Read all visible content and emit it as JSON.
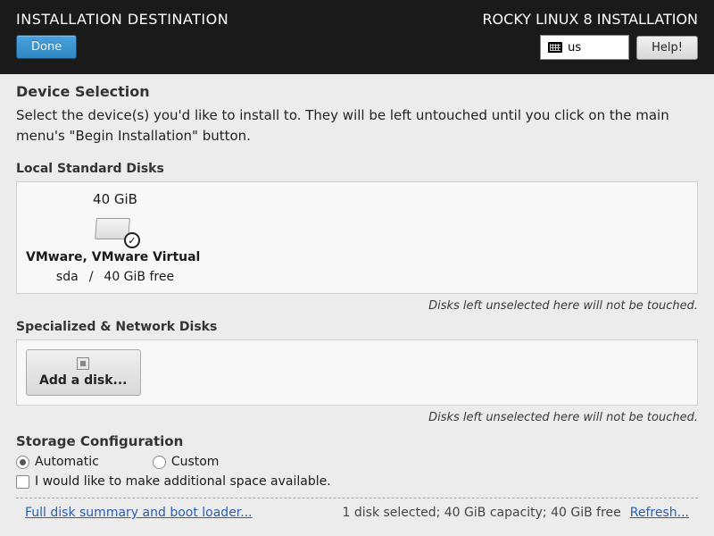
{
  "header": {
    "page_title": "INSTALLATION DESTINATION",
    "product_title": "ROCKY LINUX 8 INSTALLATION",
    "done_label": "Done",
    "help_label": "Help!",
    "keyboard_layout": "us"
  },
  "device_selection": {
    "title": "Device Selection",
    "description": "Select the device(s) you'd like to install to.  They will be left untouched until you click on the main menu's \"Begin Installation\" button."
  },
  "local_disks": {
    "title": "Local Standard Disks",
    "hint": "Disks left unselected here will not be touched.",
    "items": [
      {
        "size": "40 GiB",
        "name": "VMware, VMware Virtual S",
        "dev": "sda",
        "sep": "/",
        "free": "40 GiB free",
        "selected": true
      }
    ]
  },
  "network_disks": {
    "title": "Specialized & Network Disks",
    "add_label": "Add a disk...",
    "hint": "Disks left unselected here will not be touched."
  },
  "storage_config": {
    "title": "Storage Configuration",
    "automatic_label": "Automatic",
    "custom_label": "Custom",
    "selected": "automatic",
    "additional_space_label": "I would like to make additional space available."
  },
  "footer": {
    "summary_link": "Full disk summary and boot loader...",
    "status": "1 disk selected; 40 GiB capacity; 40 GiB free",
    "refresh_link": "Refresh..."
  }
}
